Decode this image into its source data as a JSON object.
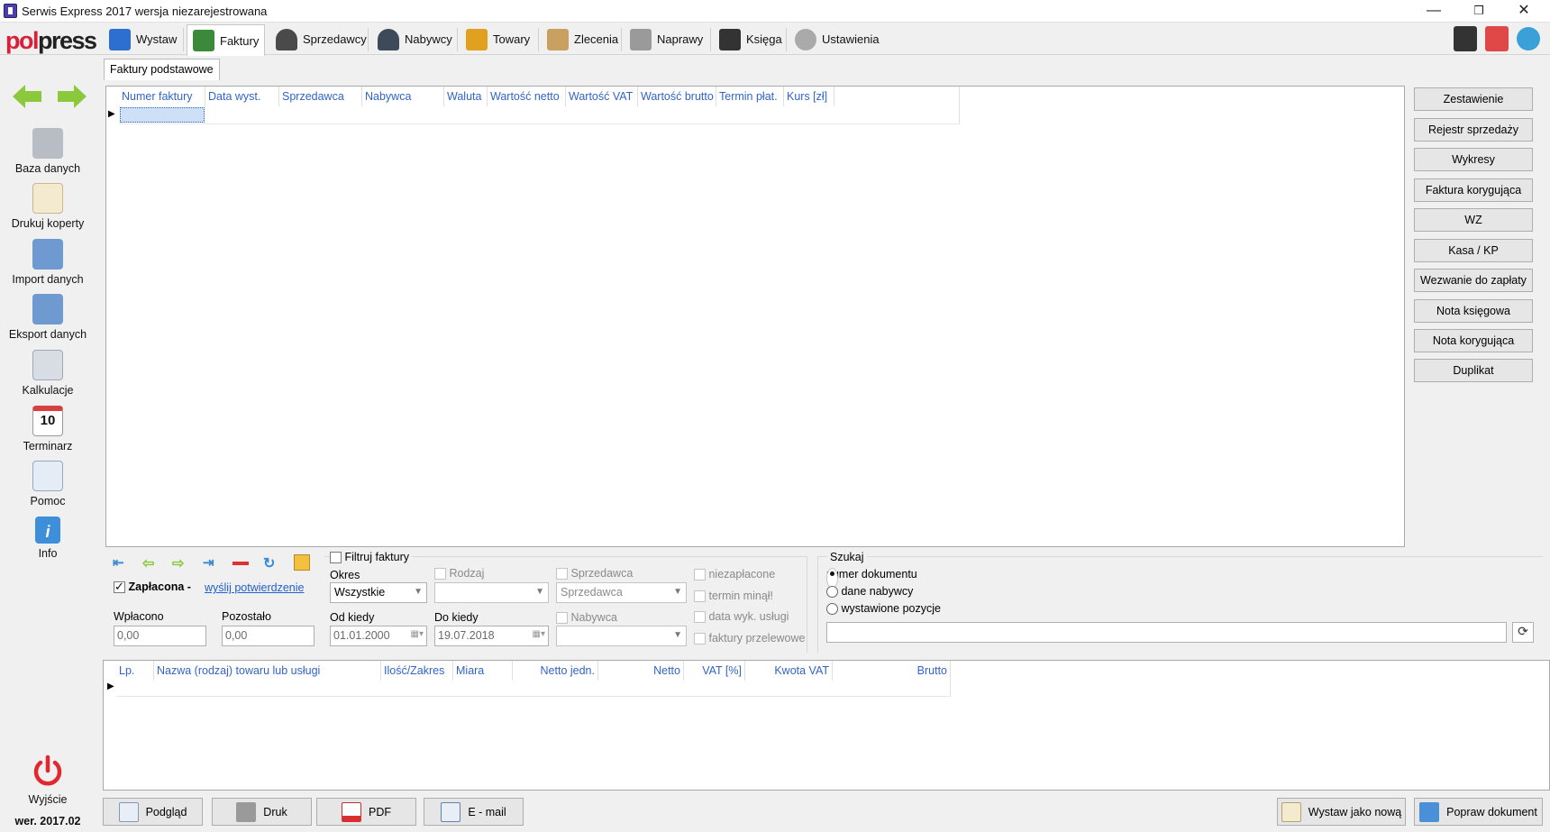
{
  "window": {
    "title": "Serwis Express 2017 wersja niezarejestrowana",
    "minimize": "—",
    "restore": "❐",
    "close": "✕"
  },
  "logo": {
    "part1": "pol",
    "part2": "press"
  },
  "tabs": [
    {
      "label": "Wystaw",
      "icon": "home-icon",
      "color": "#2c6fd1"
    },
    {
      "label": "Faktury",
      "icon": "invoice-icon",
      "color": "#3b8a3b"
    },
    {
      "label": "Sprzedawcy",
      "icon": "seller-icon",
      "color": "#4a4a4a"
    },
    {
      "label": "Nabywcy",
      "icon": "buyer-icon",
      "color": "#3d4a5a"
    },
    {
      "label": "Towary",
      "icon": "goods-icon",
      "color": "#e2a020"
    },
    {
      "label": "Zlecenia",
      "icon": "clipboard-icon",
      "color": "#c8a060"
    },
    {
      "label": "Naprawy",
      "icon": "tools-icon",
      "color": "#9a9a9a"
    },
    {
      "label": "Księga",
      "icon": "briefcase-icon",
      "color": "#333333"
    },
    {
      "label": "Ustawienia",
      "icon": "gear-icon",
      "color": "#aaaaaa"
    }
  ],
  "sidebar": {
    "items": [
      {
        "label": "Baza danych",
        "icon": "database-icon"
      },
      {
        "label": "Drukuj koperty",
        "icon": "envelope-icon"
      },
      {
        "label": "Import danych",
        "icon": "import-icon"
      },
      {
        "label": "Eksport danych",
        "icon": "export-icon"
      },
      {
        "label": "Kalkulacje",
        "icon": "calculator-icon"
      },
      {
        "label": "Terminarz",
        "icon": "calendar-icon",
        "badge": "10"
      },
      {
        "label": "Pomoc",
        "icon": "help-icon"
      },
      {
        "label": "Info",
        "icon": "info-icon",
        "badge": "i"
      }
    ],
    "exit_label": "Wyjście",
    "version": "wer. 2017.02"
  },
  "subtab": "Faktury podstawowe",
  "invoice_grid": {
    "columns": [
      "Numer faktury",
      "Data wyst.",
      "Sprzedawca",
      "Nabywca",
      "Waluta",
      "Wartość netto",
      "Wartość VAT",
      "Wartość brutto",
      "Termin płat.",
      "Kurs [zł]"
    ]
  },
  "right_buttons": [
    "Zestawienie",
    "Rejestr sprzedaży",
    "Wykresy",
    "Faktura korygująca",
    "WZ",
    "Kasa / KP",
    "Wezwanie do zapłaty",
    "Nota księgowa",
    "Nota korygująca",
    "Duplikat"
  ],
  "payment": {
    "paid_label": "Zapłacona -",
    "paid_checked": true,
    "confirm_link": "wyślij potwierdzenie",
    "paid_amount_label": "Wpłacono",
    "paid_amount": "0,00",
    "remaining_label": "Pozostało",
    "remaining": "0,00"
  },
  "filter": {
    "filter_label": "Filtruj faktury",
    "period_label": "Okres",
    "period_value": "Wszystkie",
    "kind_label": "Rodzaj",
    "seller_label": "Sprzedawca",
    "seller_value": "Sprzedawca",
    "buyer_label": "Nabywca",
    "from_label": "Od kiedy",
    "from_value": "01.01.2000",
    "to_label": "Do kiedy",
    "to_value": "19.07.2018",
    "unpaid_label": "niezapłacone",
    "overdue_label": "termin minął!",
    "service_date_label": "data wyk. usługi",
    "transfer_label": "faktury przelewowe"
  },
  "search": {
    "title": "Szukaj",
    "options": [
      "numer dokumentu",
      "dane nabywcy",
      "wystawione pozycje"
    ],
    "selected": 0,
    "value": ""
  },
  "items_grid": {
    "columns": [
      "Lp.",
      "Nazwa (rodzaj) towaru lub usługi",
      "Ilość/Zakres",
      "Miara",
      "Netto jedn.",
      "Netto",
      "VAT [%]",
      "Kwota VAT",
      "Brutto"
    ]
  },
  "bottom_buttons": [
    {
      "label": "Podgląd",
      "icon": "preview-icon"
    },
    {
      "label": "Druk",
      "icon": "printer-icon"
    },
    {
      "label": "PDF",
      "icon": "pdf-icon"
    },
    {
      "label": "E - mail",
      "icon": "email-icon"
    }
  ],
  "bottom_right_buttons": [
    {
      "label": "Wystaw jako nową",
      "icon": "edit-icon"
    },
    {
      "label": "Popraw dokument",
      "icon": "fix-document-icon"
    }
  ],
  "accent_color": "#3264c8"
}
